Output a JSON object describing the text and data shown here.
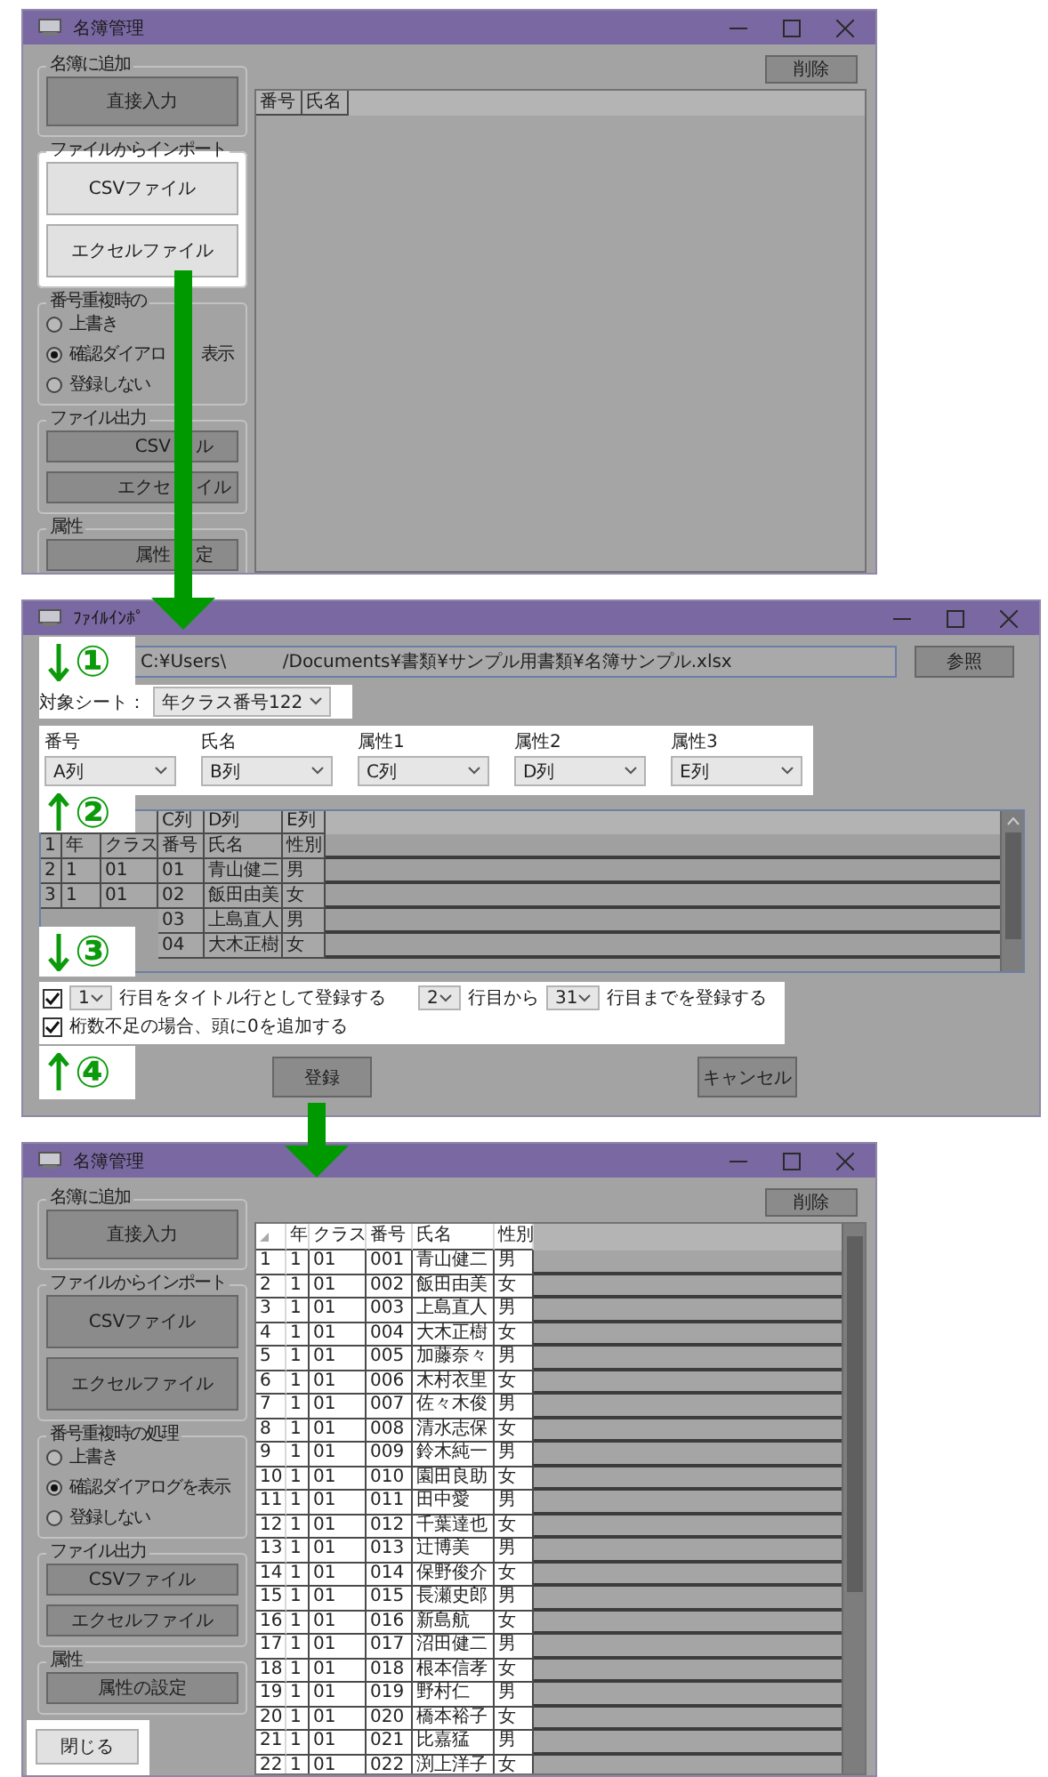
{
  "windows": [
    {
      "kind": "manager",
      "title": "名簿管理",
      "groups": [
        {
          "kind": "buttons",
          "title": "名簿に追加",
          "highlighted": false,
          "buttons": [
            {
              "label": "直接入力"
            }
          ]
        },
        {
          "kind": "buttons",
          "title": "ファイルからインポート",
          "highlighted": true,
          "buttons": [
            {
              "label": "CSVファイル"
            },
            {
              "label": "エクセルファイル"
            }
          ]
        },
        {
          "kind": "radios",
          "title": "番号重複時の",
          "options": [
            {
              "label": "上書き",
              "selected": false
            },
            {
              "label": "確認ダイアロ",
              "label_end": "表示",
              "selected": true
            },
            {
              "label": "登録しない",
              "selected": false
            }
          ]
        },
        {
          "kind": "buttons",
          "title": "ファイル出力",
          "highlighted": false,
          "buttons": [
            {
              "label": "CSV",
              "label_end": "ル"
            },
            {
              "label": "エクセ",
              "label_end": "イル"
            }
          ]
        },
        {
          "kind": "buttons",
          "title": "属性",
          "highlighted": false,
          "buttons": [
            {
              "label": "属性",
              "label_end": "定"
            }
          ]
        }
      ],
      "delete_button": "削除",
      "table": {
        "highlighted": false,
        "columns": [
          "番号",
          "氏名"
        ]
      }
    },
    {
      "kind": "import",
      "title": "ﾌｧｲﾙｲﾝﾎﾟ",
      "path": "C:¥Users\\          /Documents¥書類¥サンプル用書類¥名簿サンプル.xlsx",
      "browse_button": "参照",
      "sheet": {
        "label": "対象シート：",
        "value": "年クラス番号122"
      },
      "mappings": [
        {
          "label": "番号",
          "value": "A列"
        },
        {
          "label": "氏名",
          "value": "B列"
        },
        {
          "label": "属性1",
          "value": "C列"
        },
        {
          "label": "属性2",
          "value": "D列"
        },
        {
          "label": "属性3",
          "value": "E列"
        }
      ],
      "grid": {
        "columns": [
          "",
          "",
          "C列",
          "D列",
          "E列"
        ],
        "rows": [
          {
            "number": "1",
            "cells": [
              "年",
              "クラス",
              "番号",
              "氏名",
              "性別"
            ]
          },
          {
            "number": "2",
            "cells": [
              "1",
              "01",
              "01",
              "青山健二",
              "男"
            ]
          },
          {
            "number": "3",
            "cells": [
              "1",
              "01",
              "02",
              "飯田由美",
              "女"
            ]
          },
          {
            "cells": [
              null,
              null,
              "03",
              "上島直人",
              "男"
            ]
          },
          {
            "cells": [
              null,
              null,
              "04",
              "大木正樹",
              "女"
            ]
          }
        ]
      },
      "title_row": {
        "checked": true,
        "value": "1",
        "text": "行目をタイトル行として登録する"
      },
      "range": {
        "from": "2",
        "from_text": "行目から",
        "to": "31",
        "to_text": "行目までを登録する"
      },
      "pad_zero": {
        "checked": true,
        "text": "桁数不足の場合、頭に0を追加する"
      },
      "buttons": [
        "登録",
        "キャンセル"
      ],
      "markers": [
        {
          "number": "①",
          "kind": "down"
        },
        {
          "number": "②",
          "kind": "up"
        },
        {
          "number": "③",
          "kind": "down"
        },
        {
          "number": "④",
          "kind": "up"
        }
      ]
    },
    {
      "kind": "manager",
      "title": "名簿管理",
      "groups": [
        {
          "kind": "buttons",
          "title": "名簿に追加",
          "highlighted": false,
          "buttons": [
            {
              "label": "直接入力"
            }
          ]
        },
        {
          "kind": "buttons",
          "title": "ファイルからインポート",
          "highlighted": false,
          "buttons": [
            {
              "label": "CSVファイル"
            },
            {
              "label": "エクセルファイル"
            }
          ]
        },
        {
          "kind": "radios",
          "title": "番号重複時の処理",
          "options": [
            {
              "label": "上書き",
              "selected": false
            },
            {
              "label": "確認ダイアログを表示",
              "selected": true
            },
            {
              "label": "登録しない",
              "selected": false
            }
          ]
        },
        {
          "kind": "buttons",
          "title": "ファイル出力",
          "highlighted": false,
          "buttons": [
            {
              "label": "CSVファイル"
            },
            {
              "label": "エクセルファイル"
            }
          ]
        },
        {
          "kind": "buttons",
          "title": "属性",
          "highlighted": false,
          "buttons": [
            {
              "label": "属性の設定"
            }
          ]
        }
      ],
      "close_button": {
        "label": "閉じる",
        "highlighted": true
      },
      "delete_button": "削除",
      "table": {
        "highlighted": true,
        "columns": [
          "年",
          "クラス",
          "番号",
          "氏名",
          "性別"
        ],
        "rows": [
          {
            "number": "1",
            "cells": [
              "1",
              "01",
              "001",
              "青山健二",
              "男"
            ]
          },
          {
            "number": "2",
            "cells": [
              "1",
              "01",
              "002",
              "飯田由美",
              "女"
            ]
          },
          {
            "number": "3",
            "cells": [
              "1",
              "01",
              "003",
              "上島直人",
              "男"
            ]
          },
          {
            "number": "4",
            "cells": [
              "1",
              "01",
              "004",
              "大木正樹",
              "女"
            ]
          },
          {
            "number": "5",
            "cells": [
              "1",
              "01",
              "005",
              "加藤奈々",
              "男"
            ]
          },
          {
            "number": "6",
            "cells": [
              "1",
              "01",
              "006",
              "木村衣里",
              "女"
            ]
          },
          {
            "number": "7",
            "cells": [
              "1",
              "01",
              "007",
              "佐々木俊",
              "男"
            ]
          },
          {
            "number": "8",
            "cells": [
              "1",
              "01",
              "008",
              "清水志保",
              "女"
            ]
          },
          {
            "number": "9",
            "cells": [
              "1",
              "01",
              "009",
              "鈴木純一",
              "男"
            ]
          },
          {
            "number": "10",
            "cells": [
              "1",
              "01",
              "010",
              "園田良助",
              "女"
            ]
          },
          {
            "number": "11",
            "cells": [
              "1",
              "01",
              "011",
              "田中愛",
              "男"
            ]
          },
          {
            "number": "12",
            "cells": [
              "1",
              "01",
              "012",
              "千葉達也",
              "女"
            ]
          },
          {
            "number": "13",
            "cells": [
              "1",
              "01",
              "013",
              "辻博美",
              "男"
            ]
          },
          {
            "number": "14",
            "cells": [
              "1",
              "01",
              "014",
              "保野俊介",
              "女"
            ]
          },
          {
            "number": "15",
            "cells": [
              "1",
              "01",
              "015",
              "長瀬史郎",
              "男"
            ]
          },
          {
            "number": "16",
            "cells": [
              "1",
              "01",
              "016",
              "新島航",
              "女"
            ]
          },
          {
            "number": "17",
            "cells": [
              "1",
              "01",
              "017",
              "沼田健二",
              "男"
            ]
          },
          {
            "number": "18",
            "cells": [
              "1",
              "01",
              "018",
              "根本信孝",
              "女"
            ]
          },
          {
            "number": "19",
            "cells": [
              "1",
              "01",
              "019",
              "野村仁",
              "男"
            ]
          },
          {
            "number": "20",
            "cells": [
              "1",
              "01",
              "020",
              "橋本裕子",
              "女"
            ]
          },
          {
            "number": "21",
            "cells": [
              "1",
              "01",
              "021",
              "比嘉猛",
              "男"
            ]
          },
          {
            "number": "22",
            "cells": [
              "1",
              "01",
              "022",
              "渕上洋子",
              "女"
            ]
          }
        ]
      }
    }
  ]
}
